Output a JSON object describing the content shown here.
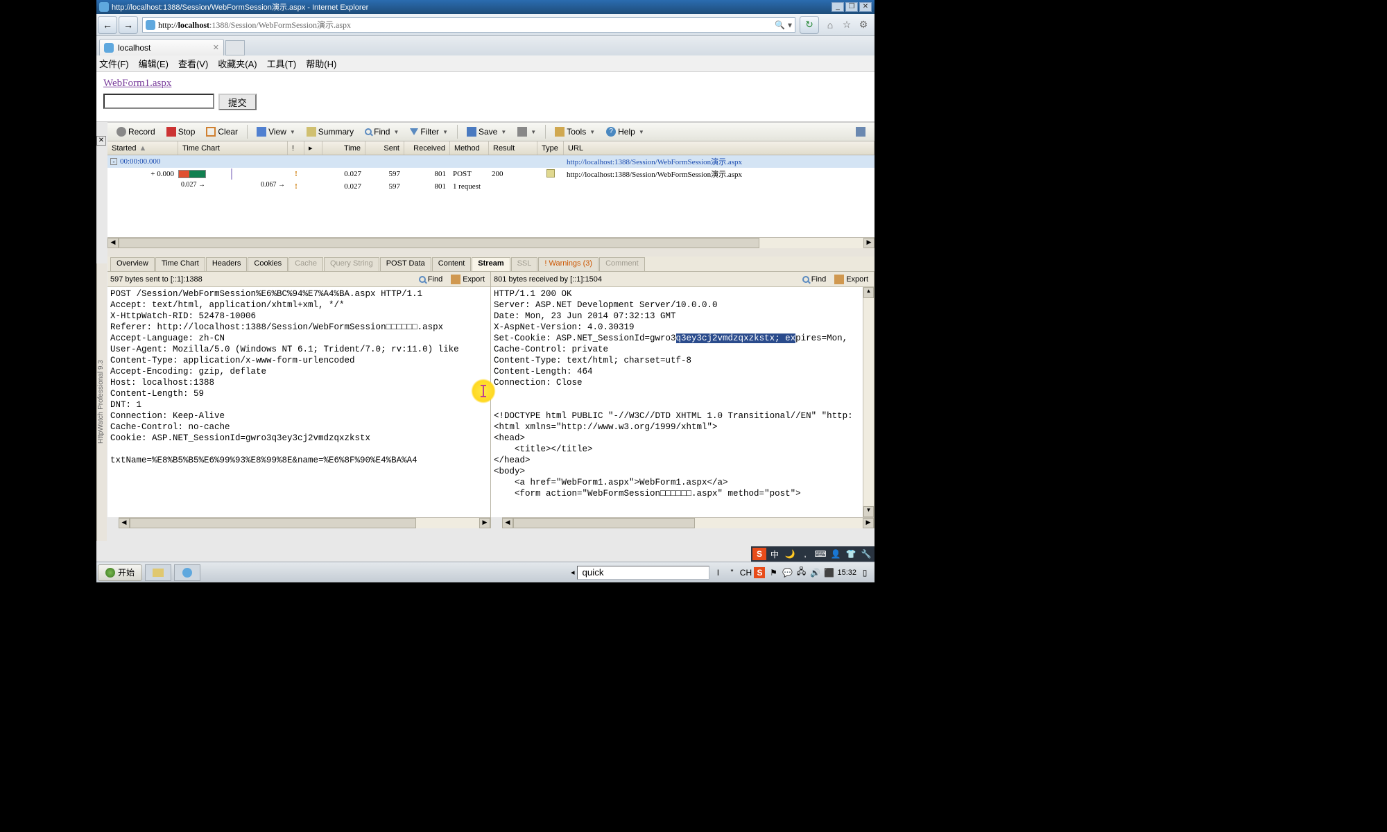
{
  "title_bar": {
    "title": "http://localhost:1388/Session/WebFormSession演示.aspx - Internet Explorer"
  },
  "url_bar": {
    "prefix": "http://",
    "host": "localhost",
    "port_path": ":1388/Session/WebFormSession演示.aspx"
  },
  "tab": {
    "label": "localhost"
  },
  "menu": {
    "file": "文件(F)",
    "edit": "编辑(E)",
    "view": "查看(V)",
    "fav": "收藏夹(A)",
    "tools": "工具(T)",
    "help": "帮助(H)"
  },
  "page": {
    "link": "WebForm1.aspx",
    "submit": "提交"
  },
  "hw_toolbar": {
    "record": "Record",
    "stop": "Stop",
    "clear": "Clear",
    "view": "View",
    "summary": "Summary",
    "find": "Find",
    "filter": "Filter",
    "save": "Save",
    "tools": "Tools",
    "help": "Help"
  },
  "grid_headers": {
    "started": "Started",
    "timechart": "Time Chart",
    "time": "Time",
    "sent": "Sent",
    "received": "Received",
    "method": "Method",
    "result": "Result",
    "type": "Type",
    "url": "URL"
  },
  "grid_rows": {
    "r0": {
      "started": "00:00:00.000",
      "url": "http://localhost:1388/Session/WebFormSession演示.aspx"
    },
    "r1": {
      "started": "+ 0.000",
      "time": "0.027",
      "sent": "597",
      "received": "801",
      "method": "POST",
      "result": "200",
      "url": "http://localhost:1388/Session/WebFormSession演示.aspx"
    },
    "r2": {
      "tc_a": "0.027 →",
      "tc_b": "0.067 →",
      "time": "0.027",
      "sent": "597",
      "received": "801",
      "method": "1 request"
    }
  },
  "detail_tabs": {
    "overview": "Overview",
    "timechart": "Time Chart",
    "headers": "Headers",
    "cookies": "Cookies",
    "cache": "Cache",
    "querystring": "Query String",
    "postdata": "POST Data",
    "content": "Content",
    "stream": "Stream",
    "ssl": "SSL",
    "warnings": "! Warnings (3)",
    "comment": "Comment"
  },
  "left_pane": {
    "status": "597 bytes sent to [::1]:1388",
    "find": "Find",
    "export": "Export",
    "text": "POST /Session/WebFormSession%E6%BC%94%E7%A4%BA.aspx HTTP/1.1\nAccept: text/html, application/xhtml+xml, */*\nX-HttpWatch-RID: 52478-10006\nReferer: http://localhost:1388/Session/WebFormSession□□□□□□.aspx\nAccept-Language: zh-CN\nUser-Agent: Mozilla/5.0 (Windows NT 6.1; Trident/7.0; rv:11.0) like\nContent-Type: application/x-www-form-urlencoded\nAccept-Encoding: gzip, deflate\nHost: localhost:1388\nContent-Length: 59\nDNT: 1\nConnection: Keep-Alive\nCache-Control: no-cache\nCookie: ASP.NET_SessionId=gwro3q3ey3cj2vmdzqxzkstx\n\ntxtName=%E8%B5%B5%E6%99%93%E8%99%8E&name=%E6%8F%90%E4%BA%A4"
  },
  "right_pane": {
    "status": "801 bytes received by [::1]:1504",
    "find": "Find",
    "export": "Export",
    "pre": "HTTP/1.1 200 OK\nServer: ASP.NET Development Server/10.0.0.0\nDate: Mon, 23 Jun 2014 07:32:13 GMT\nX-AspNet-Version: 4.0.30319\nSet-Cookie: ASP.NET_SessionId=gwro3",
    "sel": "q3ey3cj2vmdzqxzkstx; ex",
    "post": "pires=Mon,\nCache-Control: private\nContent-Type: text/html; charset=utf-8\nContent-Length: 464\nConnection: Close\n\n\n<!DOCTYPE html PUBLIC \"-//W3C//DTD XHTML 1.0 Transitional//EN\" \"http:\n<html xmlns=\"http://www.w3.org/1999/xhtml\">\n<head>\n    <title></title>\n</head>\n<body>\n    <a href=\"WebForm1.aspx\">WebForm1.aspx</a>\n    <form action=\"WebFormSession□□□□□□.aspx\" method=\"post\">"
  },
  "side_label": "HttpWatch Professional 9.3",
  "taskbar": {
    "start": "开始",
    "quick": "quick",
    "ch": "CH",
    "time": "15:32"
  }
}
